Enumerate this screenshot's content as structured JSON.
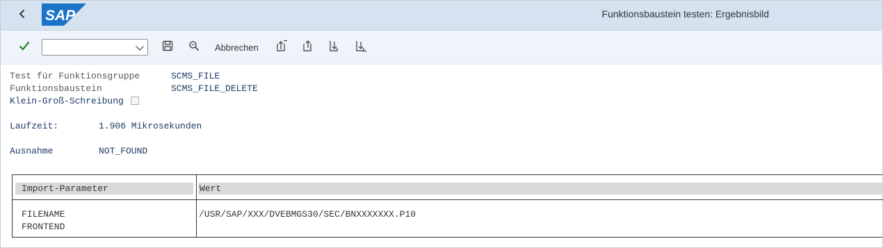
{
  "window": {
    "title": "Funktionsbaustein testen: Ergebnisbild"
  },
  "brand": {
    "logo_text": "SAP",
    "logo_color": "#1a73c9"
  },
  "toolbar": {
    "command_field": {
      "value": "",
      "placeholder": ""
    },
    "cancel_label": "Abbrechen",
    "icons": [
      "back-icon",
      "check-icon",
      "chevron-down-icon",
      "save-icon",
      "find-icon",
      "first-page-icon",
      "previous-page-icon",
      "next-page-icon",
      "last-page-icon"
    ]
  },
  "info": {
    "group_label": "Test für Funktionsgruppe",
    "group_value": "SCMS_FILE",
    "module_label": "Funktionsbaustein",
    "module_value": "SCMS_FILE_DELETE",
    "case_label": "Klein-Groß-Schreibung",
    "case_checked": false,
    "runtime_label": "Laufzeit:",
    "runtime_value": "1.906 Mikrosekunden",
    "exception_label": "Ausnahme",
    "exception_value": "NOT_FOUND"
  },
  "table": {
    "headers": [
      "Import-Parameter",
      "Wert"
    ],
    "rows": [
      {
        "param": "FILENAME",
        "value": "/USR/SAP/XXX/DVEBMGS30/SEC/BNXXXXXXX.P10"
      },
      {
        "param": "FRONTEND",
        "value": ""
      }
    ]
  },
  "colors": {
    "titlebar": "#d5e2ef",
    "toolbar": "#eef4f9",
    "value_text": "#1c3b63",
    "check_green": "#2b7d2b"
  }
}
